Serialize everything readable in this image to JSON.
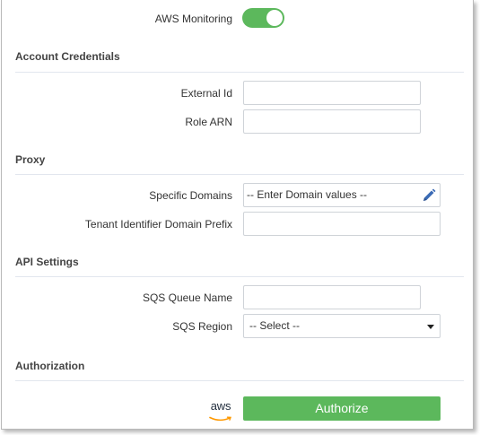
{
  "monitoring": {
    "label": "AWS Monitoring",
    "enabled": true
  },
  "account_credentials": {
    "heading": "Account Credentials",
    "external_id": {
      "label": "External Id",
      "value": ""
    },
    "role_arn": {
      "label": "Role ARN",
      "value": ""
    }
  },
  "proxy": {
    "heading": "Proxy",
    "specific_domains": {
      "label": "Specific Domains",
      "placeholder": "-- Enter Domain values --"
    },
    "tenant_prefix": {
      "label": "Tenant Identifier Domain Prefix",
      "value": ""
    }
  },
  "api_settings": {
    "heading": "API Settings",
    "sqs_queue_name": {
      "label": "SQS Queue Name",
      "value": ""
    },
    "sqs_region": {
      "label": "SQS Region",
      "selected": "-- Select --"
    }
  },
  "authorization": {
    "heading": "Authorization",
    "logo_text": "aws",
    "button_label": "Authorize"
  },
  "colors": {
    "accent": "#5cb85c",
    "divider": "#e2e6ee",
    "icon_blue": "#3b6bb5"
  },
  "icons": {
    "edit": "pencil-icon",
    "dropdown": "caret-down-icon",
    "logo": "aws-logo"
  }
}
